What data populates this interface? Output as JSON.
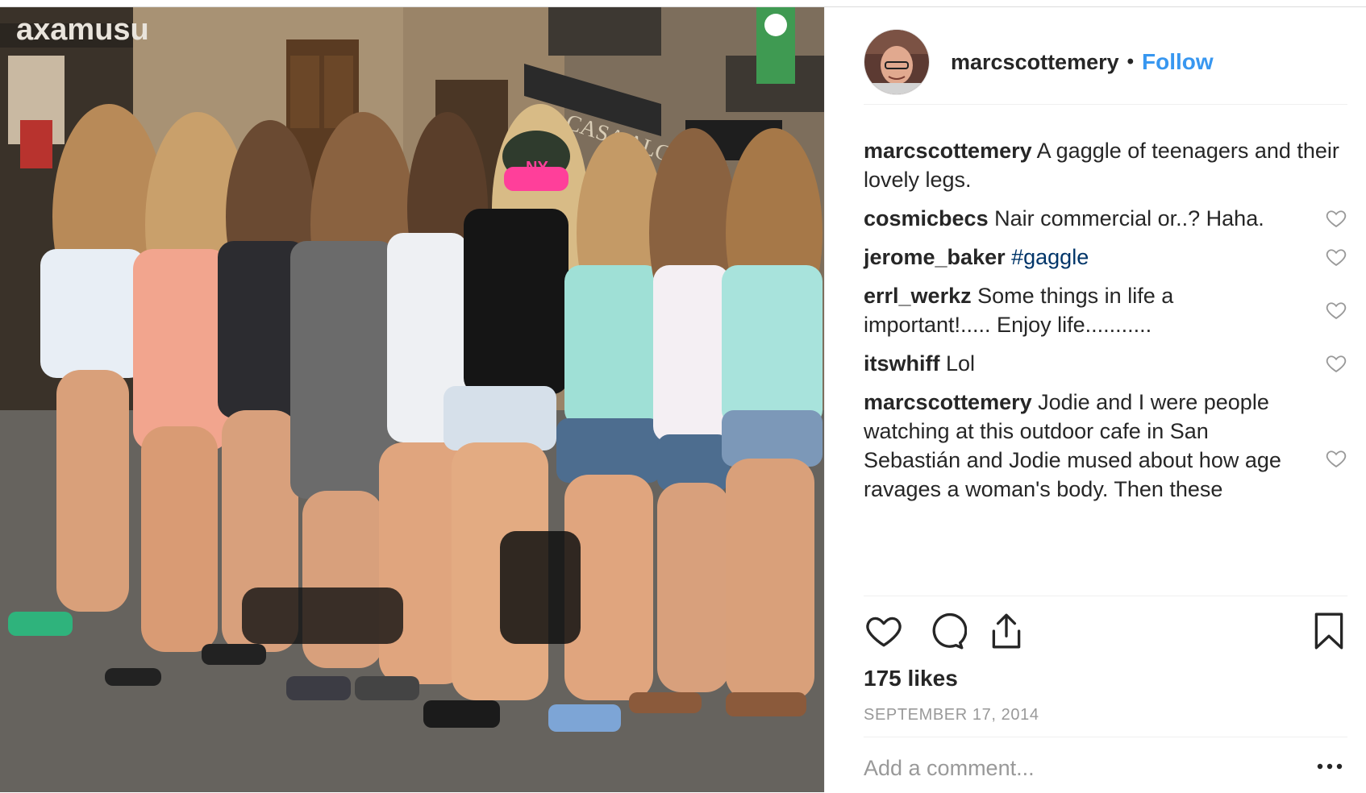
{
  "post": {
    "author": "marcscottemery",
    "follow_separator": "•",
    "follow_label": "Follow"
  },
  "photo": {
    "storefront_text": "axamusu",
    "sign_text": "CASA ALCALDE",
    "cap_logo": "NY"
  },
  "comments": [
    {
      "user": "marcscottemery",
      "text": " A gaggle of teenagers and their lovely legs.",
      "has_heart": false
    },
    {
      "user": "cosmicbecs",
      "text": " Nair commercial or..? Haha.",
      "has_heart": true
    },
    {
      "user": "jerome_baker",
      "tag": " #gaggle",
      "text": "",
      "has_heart": true
    },
    {
      "user": "errl_werkz",
      "text": " Some things in life a important!..... Enjoy life...........",
      "has_heart": true
    },
    {
      "user": "itswhiff",
      "text": " Lol",
      "has_heart": true
    },
    {
      "user": "marcscottemery",
      "text": " Jodie and I were people watching at this outdoor cafe in San Sebastián and Jodie mused about how age ravages a woman's body. Then these youthful women came by and we contemplated the undeniable",
      "has_heart": true
    }
  ],
  "stats": {
    "likes": "175 likes",
    "date": "SEPTEMBER 17, 2014"
  },
  "add_comment": {
    "placeholder": "Add a comment...",
    "more_label": "•••"
  },
  "colors": {
    "link_blue": "#3897f0",
    "hashtag": "#003569",
    "muted": "#999999",
    "text": "#262626"
  },
  "icons": [
    "heart-icon",
    "comment-icon",
    "share-icon",
    "bookmark-icon",
    "more-options-icon"
  ]
}
